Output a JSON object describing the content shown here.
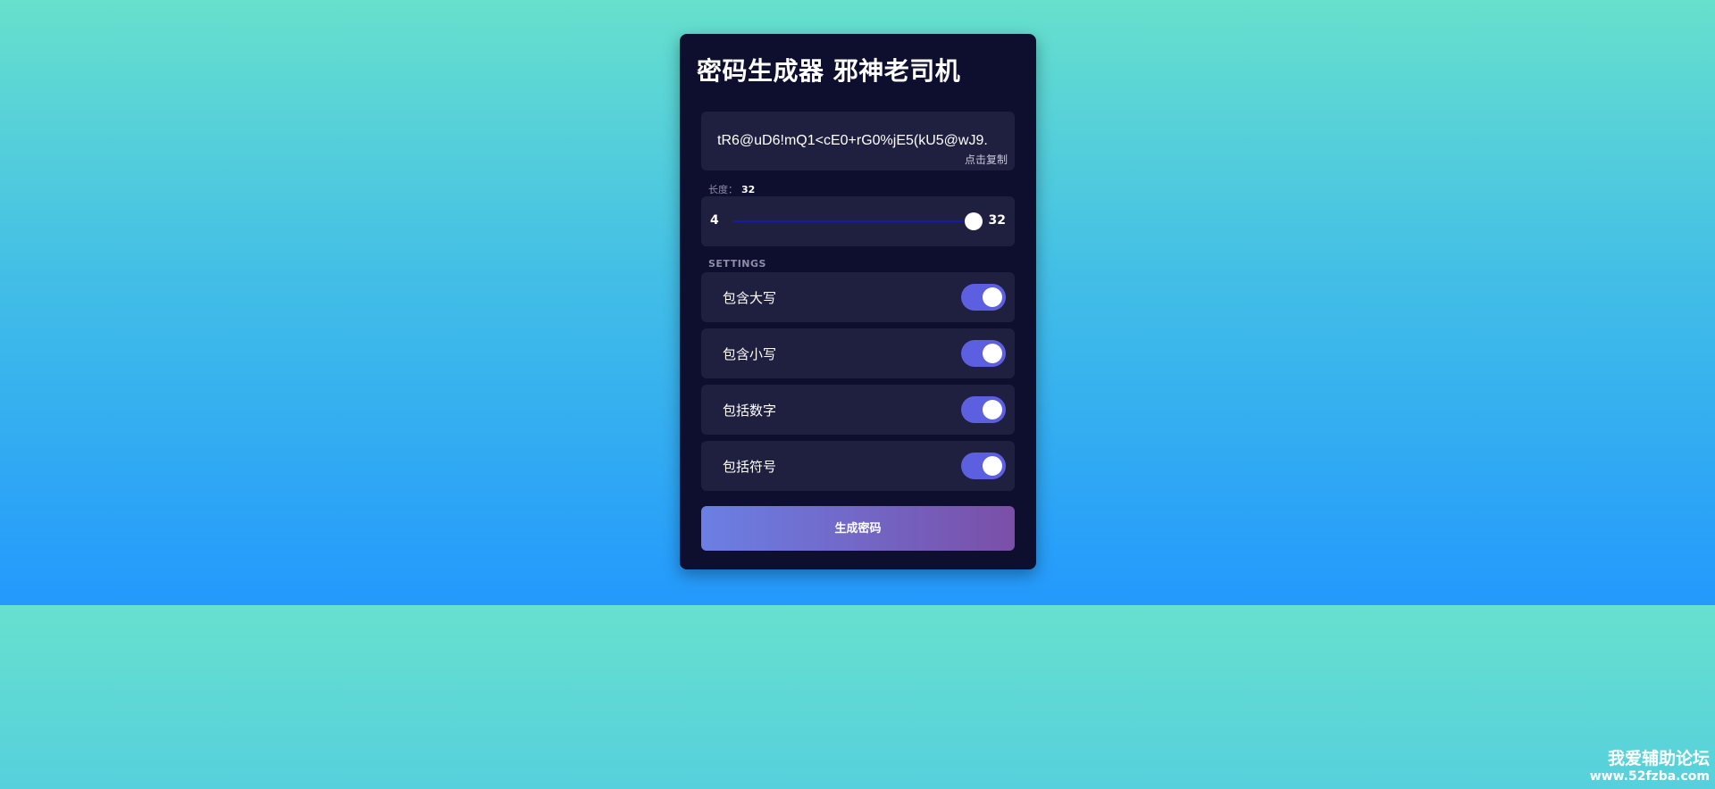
{
  "card": {
    "title": "密码生成器 邪神老司机"
  },
  "result": {
    "password": "tR6@uD6!mQ1<cE0+rG0%jE5(kU5@wJ9.",
    "copy_hint": "点击复制"
  },
  "length": {
    "label": "长度：",
    "value": "32",
    "min": "4",
    "max": "32",
    "current": 32
  },
  "settings": {
    "title": "SETTINGS",
    "items": [
      {
        "label": "包含大写",
        "enabled": true
      },
      {
        "label": "包含小写",
        "enabled": true
      },
      {
        "label": "包括数字",
        "enabled": true
      },
      {
        "label": "包括符号",
        "enabled": true
      }
    ]
  },
  "actions": {
    "generate_label": "生成密码"
  },
  "watermark": {
    "name": "我爱辅助论坛",
    "url": "www.52fzba.com"
  },
  "colors": {
    "card_bg": "#0e0e2f",
    "panel_bg": "#1f1f40",
    "toggle_on": "#5b5fe0",
    "button_gradient_start": "#6b7fe4",
    "button_gradient_end": "#7a4fa8"
  }
}
